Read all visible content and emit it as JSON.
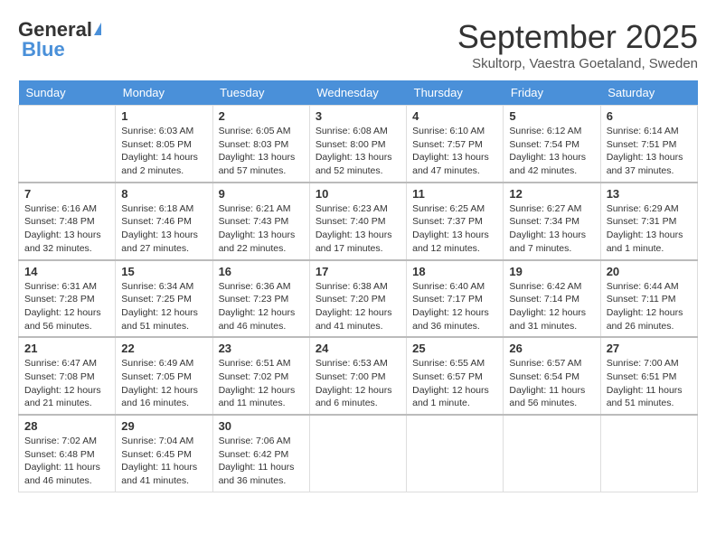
{
  "header": {
    "logo_general": "General",
    "logo_blue": "Blue",
    "month_title": "September 2025",
    "location": "Skultorp, Vaestra Goetaland, Sweden"
  },
  "days_of_week": [
    "Sunday",
    "Monday",
    "Tuesday",
    "Wednesday",
    "Thursday",
    "Friday",
    "Saturday"
  ],
  "weeks": [
    [
      {
        "day": "",
        "info": ""
      },
      {
        "day": "1",
        "info": "Sunrise: 6:03 AM\nSunset: 8:05 PM\nDaylight: 14 hours\nand 2 minutes."
      },
      {
        "day": "2",
        "info": "Sunrise: 6:05 AM\nSunset: 8:03 PM\nDaylight: 13 hours\nand 57 minutes."
      },
      {
        "day": "3",
        "info": "Sunrise: 6:08 AM\nSunset: 8:00 PM\nDaylight: 13 hours\nand 52 minutes."
      },
      {
        "day": "4",
        "info": "Sunrise: 6:10 AM\nSunset: 7:57 PM\nDaylight: 13 hours\nand 47 minutes."
      },
      {
        "day": "5",
        "info": "Sunrise: 6:12 AM\nSunset: 7:54 PM\nDaylight: 13 hours\nand 42 minutes."
      },
      {
        "day": "6",
        "info": "Sunrise: 6:14 AM\nSunset: 7:51 PM\nDaylight: 13 hours\nand 37 minutes."
      }
    ],
    [
      {
        "day": "7",
        "info": "Sunrise: 6:16 AM\nSunset: 7:48 PM\nDaylight: 13 hours\nand 32 minutes."
      },
      {
        "day": "8",
        "info": "Sunrise: 6:18 AM\nSunset: 7:46 PM\nDaylight: 13 hours\nand 27 minutes."
      },
      {
        "day": "9",
        "info": "Sunrise: 6:21 AM\nSunset: 7:43 PM\nDaylight: 13 hours\nand 22 minutes."
      },
      {
        "day": "10",
        "info": "Sunrise: 6:23 AM\nSunset: 7:40 PM\nDaylight: 13 hours\nand 17 minutes."
      },
      {
        "day": "11",
        "info": "Sunrise: 6:25 AM\nSunset: 7:37 PM\nDaylight: 13 hours\nand 12 minutes."
      },
      {
        "day": "12",
        "info": "Sunrise: 6:27 AM\nSunset: 7:34 PM\nDaylight: 13 hours\nand 7 minutes."
      },
      {
        "day": "13",
        "info": "Sunrise: 6:29 AM\nSunset: 7:31 PM\nDaylight: 13 hours\nand 1 minute."
      }
    ],
    [
      {
        "day": "14",
        "info": "Sunrise: 6:31 AM\nSunset: 7:28 PM\nDaylight: 12 hours\nand 56 minutes."
      },
      {
        "day": "15",
        "info": "Sunrise: 6:34 AM\nSunset: 7:25 PM\nDaylight: 12 hours\nand 51 minutes."
      },
      {
        "day": "16",
        "info": "Sunrise: 6:36 AM\nSunset: 7:23 PM\nDaylight: 12 hours\nand 46 minutes."
      },
      {
        "day": "17",
        "info": "Sunrise: 6:38 AM\nSunset: 7:20 PM\nDaylight: 12 hours\nand 41 minutes."
      },
      {
        "day": "18",
        "info": "Sunrise: 6:40 AM\nSunset: 7:17 PM\nDaylight: 12 hours\nand 36 minutes."
      },
      {
        "day": "19",
        "info": "Sunrise: 6:42 AM\nSunset: 7:14 PM\nDaylight: 12 hours\nand 31 minutes."
      },
      {
        "day": "20",
        "info": "Sunrise: 6:44 AM\nSunset: 7:11 PM\nDaylight: 12 hours\nand 26 minutes."
      }
    ],
    [
      {
        "day": "21",
        "info": "Sunrise: 6:47 AM\nSunset: 7:08 PM\nDaylight: 12 hours\nand 21 minutes."
      },
      {
        "day": "22",
        "info": "Sunrise: 6:49 AM\nSunset: 7:05 PM\nDaylight: 12 hours\nand 16 minutes."
      },
      {
        "day": "23",
        "info": "Sunrise: 6:51 AM\nSunset: 7:02 PM\nDaylight: 12 hours\nand 11 minutes."
      },
      {
        "day": "24",
        "info": "Sunrise: 6:53 AM\nSunset: 7:00 PM\nDaylight: 12 hours\nand 6 minutes."
      },
      {
        "day": "25",
        "info": "Sunrise: 6:55 AM\nSunset: 6:57 PM\nDaylight: 12 hours\nand 1 minute."
      },
      {
        "day": "26",
        "info": "Sunrise: 6:57 AM\nSunset: 6:54 PM\nDaylight: 11 hours\nand 56 minutes."
      },
      {
        "day": "27",
        "info": "Sunrise: 7:00 AM\nSunset: 6:51 PM\nDaylight: 11 hours\nand 51 minutes."
      }
    ],
    [
      {
        "day": "28",
        "info": "Sunrise: 7:02 AM\nSunset: 6:48 PM\nDaylight: 11 hours\nand 46 minutes."
      },
      {
        "day": "29",
        "info": "Sunrise: 7:04 AM\nSunset: 6:45 PM\nDaylight: 11 hours\nand 41 minutes."
      },
      {
        "day": "30",
        "info": "Sunrise: 7:06 AM\nSunset: 6:42 PM\nDaylight: 11 hours\nand 36 minutes."
      },
      {
        "day": "",
        "info": ""
      },
      {
        "day": "",
        "info": ""
      },
      {
        "day": "",
        "info": ""
      },
      {
        "day": "",
        "info": ""
      }
    ]
  ]
}
